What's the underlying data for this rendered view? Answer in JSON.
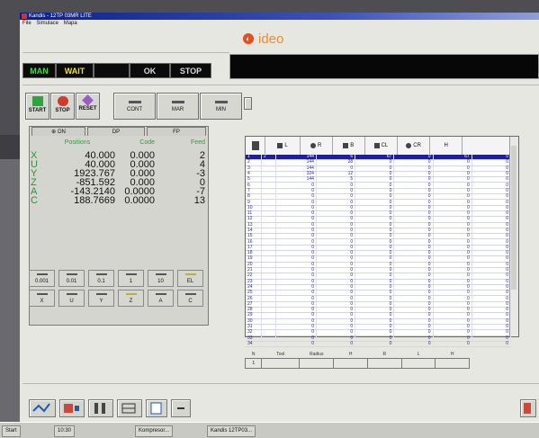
{
  "window": {
    "title": "Kandis - 12TP 03MR LITE",
    "menu": [
      "File",
      "Simulace",
      "Mapa"
    ]
  },
  "logo": {
    "text": "ideo"
  },
  "status": {
    "man": "MAN",
    "wait": "WAIT",
    "ok": "OK",
    "stop": "STOP"
  },
  "toolbar": {
    "start": "START",
    "stop": "STOP",
    "reset": "RESET",
    "cont": "CONT",
    "mar": "MAR",
    "min": "MIN"
  },
  "left_panel": {
    "tabs": [
      "ON",
      "DP",
      "FP"
    ],
    "headers": {
      "position": "Positions",
      "code": "Code",
      "feed": "Feed"
    },
    "rows": [
      {
        "axis": "X",
        "value": "40.000",
        "code": "0.000",
        "feed": "2"
      },
      {
        "axis": "U",
        "value": "40.000",
        "code": "0.000",
        "feed": "4"
      },
      {
        "axis": "Y",
        "value": "1923.767",
        "code": "0.000",
        "feed": "-3"
      },
      {
        "axis": "Z",
        "value": "-851.592",
        "code": "0.000",
        "feed": "0"
      },
      {
        "axis": "A",
        "value": "-143.2140",
        "code": "0.0000",
        "feed": "-7"
      },
      {
        "axis": "C",
        "value": "188.7669",
        "code": "0.0000",
        "feed": "13"
      }
    ],
    "steps": [
      "0.001",
      "0.01",
      "0.1",
      "1",
      "10",
      "EL"
    ],
    "axes": [
      "X",
      "U",
      "Y",
      "Z",
      "A",
      "C"
    ]
  },
  "grid": {
    "headers": [
      "L",
      "R",
      "B",
      "CL",
      "CR",
      "H"
    ],
    "rows": [
      [
        "1",
        "2",
        "144",
        "6",
        "67",
        "0",
        "67",
        "0"
      ],
      [
        "2",
        "",
        "144",
        "28",
        "0",
        "0",
        "0",
        "0"
      ],
      [
        "3",
        "",
        "144",
        "0",
        "0",
        "0",
        "0",
        "0"
      ],
      [
        "4",
        "",
        "324",
        "12",
        "0",
        "0",
        "0",
        "0"
      ],
      [
        "5",
        "",
        "144",
        "5",
        "0",
        "0",
        "0",
        "0"
      ],
      [
        "6",
        "",
        "0",
        "0",
        "0",
        "0",
        "0",
        "0"
      ],
      [
        "7",
        "",
        "0",
        "0",
        "0",
        "0",
        "0",
        "0"
      ],
      [
        "8",
        "",
        "0",
        "0",
        "0",
        "0",
        "0",
        "0"
      ],
      [
        "9",
        "",
        "0",
        "0",
        "0",
        "0",
        "0",
        "0"
      ],
      [
        "10",
        "",
        "0",
        "0",
        "0",
        "0",
        "0",
        "0"
      ],
      [
        "11",
        "",
        "0",
        "0",
        "0",
        "0",
        "0",
        "0"
      ],
      [
        "12",
        "",
        "0",
        "0",
        "0",
        "0",
        "0",
        "0"
      ],
      [
        "13",
        "",
        "0",
        "0",
        "0",
        "0",
        "0",
        "0"
      ],
      [
        "14",
        "",
        "0",
        "0",
        "0",
        "0",
        "0",
        "0"
      ],
      [
        "15",
        "",
        "0",
        "0",
        "0",
        "0",
        "0",
        "0"
      ],
      [
        "16",
        "",
        "0",
        "0",
        "0",
        "0",
        "0",
        "0"
      ],
      [
        "17",
        "",
        "0",
        "0",
        "0",
        "0",
        "0",
        "0"
      ],
      [
        "18",
        "",
        "0",
        "0",
        "0",
        "0",
        "0",
        "0"
      ],
      [
        "19",
        "",
        "0",
        "0",
        "0",
        "0",
        "0",
        "0"
      ],
      [
        "20",
        "",
        "0",
        "0",
        "0",
        "0",
        "0",
        "0"
      ],
      [
        "21",
        "",
        "0",
        "0",
        "0",
        "0",
        "0",
        "0"
      ],
      [
        "22",
        "",
        "0",
        "0",
        "0",
        "0",
        "0",
        "0"
      ],
      [
        "23",
        "",
        "0",
        "0",
        "0",
        "0",
        "0",
        "0"
      ],
      [
        "24",
        "",
        "0",
        "0",
        "0",
        "0",
        "0",
        "0"
      ],
      [
        "25",
        "",
        "0",
        "0",
        "0",
        "0",
        "0",
        "0"
      ],
      [
        "26",
        "",
        "0",
        "0",
        "0",
        "0",
        "0",
        "0"
      ],
      [
        "27",
        "",
        "0",
        "0",
        "0",
        "0",
        "0",
        "0"
      ],
      [
        "28",
        "",
        "0",
        "0",
        "0",
        "0",
        "0",
        "0"
      ],
      [
        "29",
        "",
        "0",
        "0",
        "0",
        "0",
        "0",
        "0"
      ],
      [
        "30",
        "",
        "0",
        "0",
        "0",
        "0",
        "0",
        "0"
      ],
      [
        "31",
        "",
        "0",
        "0",
        "0",
        "0",
        "0",
        "0"
      ],
      [
        "32",
        "",
        "0",
        "0",
        "0",
        "0",
        "0",
        "0"
      ],
      [
        "33",
        "",
        "0",
        "0",
        "0",
        "0",
        "0",
        "0"
      ],
      [
        "34",
        "",
        "0",
        "0",
        "0",
        "0",
        "0",
        "0"
      ]
    ]
  },
  "mini_table": {
    "headers": [
      "N",
      "Tool",
      "Radius",
      "H",
      "R",
      "L",
      "H"
    ],
    "row": [
      "1",
      "",
      "",
      "",
      "",
      "",
      ""
    ]
  },
  "taskbar": {
    "start": "Start",
    "clock": "10:30",
    "items": [
      "Kompresor...",
      "Kandis 12TP03..."
    ]
  },
  "colors": {
    "axis": "#1f9a30",
    "selected_row": "#1f1f9a",
    "status_bg": "#0b0b0b"
  }
}
